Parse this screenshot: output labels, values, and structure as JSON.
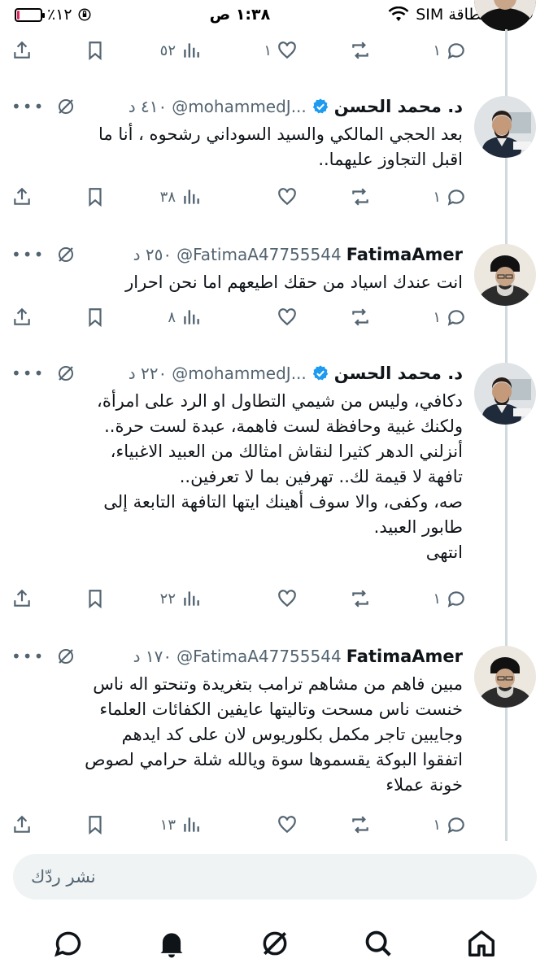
{
  "status_bar": {
    "carrier": "لا توجد بطاقة SIM",
    "time": "١:٣٨ ص",
    "battery_percent": "٪١٢",
    "battery_level": 0.12
  },
  "top_actions": {
    "replies": "١",
    "likes": "١",
    "views": "٥٢"
  },
  "tweets": [
    {
      "name": "د. محمد الحسن",
      "handle": "@mohammedJ...",
      "time": "٤١٠ د",
      "verified": true,
      "text": "بعد الحجي المالكي والسيد السوداني رشحوه ، أنا ما\nاقبل التجاوز عليهما..",
      "replies": "١",
      "likes": "",
      "views": "٣٨"
    },
    {
      "name": "FatimaAmer",
      "handle": "@FatimaA47755544",
      "time": "٢٥٠ د",
      "verified": false,
      "text": "انت عندك اسياد   من حقك اطيعهم  اما نحن احرار",
      "replies": "١",
      "likes": "",
      "views": "٨"
    },
    {
      "name": "د. محمد الحسن",
      "handle": "@mohammedJ...",
      "time": "٢٢٠ د",
      "verified": true,
      "text": "دكافي، وليس من شيمي التطاول او الرد على امرأة،\nولكنك غبية وحافظة لست فاهمة، عبدة لست حرة..\nأنزلني الدهر كثيرا لنقاش امثالك من العبيد الاغبياء،\nتافهة لا قيمة لك.. تهرفين بما لا تعرفين..\nصه، وكفى، والا سوف أهينك ايتها التافهة التابعة إلى\nطابور العبيد.\nانتهى",
      "replies": "١",
      "likes": "",
      "views": "٢٢"
    },
    {
      "name": "FatimaAmer",
      "handle": "@FatimaA47755544",
      "time": "١٧٠ د",
      "verified": false,
      "text": "مبين فاهم من مشاهم ترامب بتغريدة وتنحتو اله ناس\nخنست ناس مسحت وتاليتها عايفين الكفائات العلماء\nوجايبين تاجر مكمل بكلوريوس  لان على كد ايدهم\nاتفقوا البوكة يقسموها سوة ويالله  شلة حرامي لصوص\nخونة عملاء",
      "replies": "١",
      "likes": "",
      "views": "١٣"
    }
  ],
  "reply_bar": {
    "placeholder": "نشر ردّك"
  },
  "icons": {
    "nav": [
      "chat-icon",
      "notifications-icon",
      "grok-icon",
      "search-icon",
      "home-icon"
    ]
  },
  "colors": {
    "verified": "#1d9bf0",
    "secondary": "#536471",
    "thread_line": "#cfd9de"
  }
}
